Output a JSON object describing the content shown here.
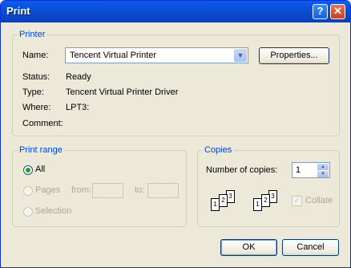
{
  "window": {
    "title": "Print",
    "help_glyph": "?",
    "close_glyph": "✕"
  },
  "printer": {
    "legend": "Printer",
    "name_label": "Name:",
    "name_value": "Tencent Virtual Printer",
    "properties_label": "Properties...",
    "status_label": "Status:",
    "status_value": "Ready",
    "type_label": "Type:",
    "type_value": "Tencent Virtual Printer Driver",
    "where_label": "Where:",
    "where_value": "LPT3:",
    "comment_label": "Comment:"
  },
  "print_range": {
    "legend": "Print range",
    "all_label": "All",
    "pages_label": "Pages",
    "from_label": "from:",
    "to_label": "to:",
    "selection_label": "Selection",
    "selected": "all"
  },
  "copies": {
    "legend": "Copies",
    "number_label": "Number of copies:",
    "number_value": "1",
    "collate_label": "Collate",
    "collate_checked": true,
    "page_numbers": [
      "1",
      "2",
      "3"
    ]
  },
  "buttons": {
    "ok": "OK",
    "cancel": "Cancel"
  }
}
